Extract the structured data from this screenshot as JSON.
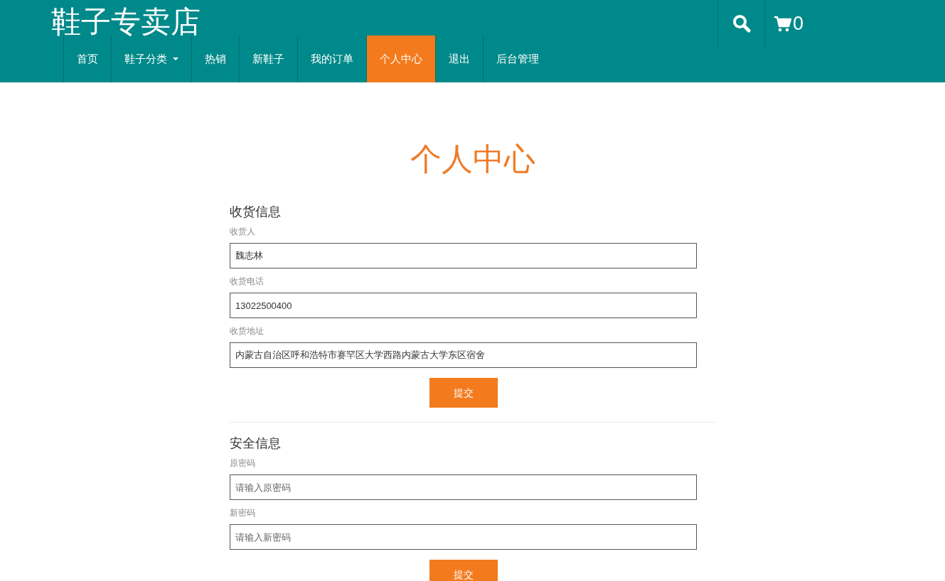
{
  "header": {
    "logo": "鞋子专卖店",
    "cart_count": "0"
  },
  "nav": [
    {
      "label": "首页",
      "selected": false,
      "dropdown": false
    },
    {
      "label": "鞋子分类",
      "selected": false,
      "dropdown": true
    },
    {
      "label": "热销",
      "selected": false,
      "dropdown": false
    },
    {
      "label": "新鞋子",
      "selected": false,
      "dropdown": false
    },
    {
      "label": "我的订单",
      "selected": false,
      "dropdown": false
    },
    {
      "label": "个人中心",
      "selected": true,
      "dropdown": false
    },
    {
      "label": "退出",
      "selected": false,
      "dropdown": false
    },
    {
      "label": "后台管理",
      "selected": false,
      "dropdown": false
    }
  ],
  "page_title": "个人中心",
  "sections": [
    {
      "heading": "收货信息",
      "fields": [
        {
          "label": "收货人",
          "value": "魏志林"
        },
        {
          "label": "收货电话",
          "value": "13022500400"
        },
        {
          "label": "收货地址",
          "value": "内蒙古自治区呼和浩特市赛罕区大学西路内蒙古大学东区宿舍"
        }
      ],
      "button": "提交"
    },
    {
      "heading": "安全信息",
      "fields": [
        {
          "label": "原密码",
          "placeholder": "请输入原密码"
        },
        {
          "label": "新密码",
          "placeholder": "请输入新密码"
        }
      ],
      "button": "提交"
    }
  ]
}
